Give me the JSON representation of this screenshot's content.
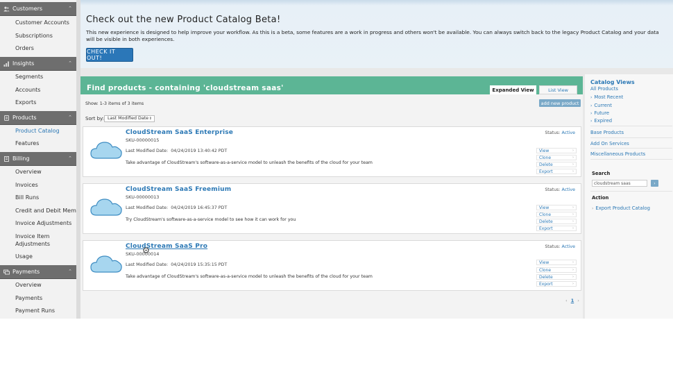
{
  "sidebar": {
    "sections": [
      {
        "title": "Customers",
        "items": [
          "Customer Accounts",
          "Subscriptions",
          "Orders"
        ]
      },
      {
        "title": "Insights",
        "items": [
          "Segments",
          "Accounts",
          "Exports"
        ]
      },
      {
        "title": "Products",
        "items": [
          "Product Catalog",
          "Features"
        ],
        "active_item": "Product Catalog"
      },
      {
        "title": "Billing",
        "items": [
          "Overview",
          "Invoices",
          "Bill Runs",
          "Credit and Debit Memos",
          "Invoice Adjustments",
          "Invoice Item Adjustments",
          "Usage"
        ]
      },
      {
        "title": "Payments",
        "items": [
          "Overview",
          "Payments",
          "Payment Runs"
        ]
      }
    ]
  },
  "banner": {
    "title": "Check out the new Product Catalog Beta!",
    "text": "This new experience is designed to help improve your workflow. As this is a beta, some features are a work in progress and others won't be available. You can always switch back to the legacy Product Catalog and your data will be visible in both experiences.",
    "button_label": "CHECK IT OUT!"
  },
  "results": {
    "title": "Find products - containing 'cloudstream saas'",
    "tab_expanded": "Expanded View",
    "tab_list": "List View",
    "show_text": "Show: 1-3 items of 3 items",
    "add_button": "add new product",
    "sort_label": "Sort by:",
    "sort_value": "Last Modified Date",
    "date_label": "Last Modified Date:",
    "status_label": "Status:",
    "actions": [
      "View",
      "Clone",
      "Delete",
      "Export"
    ],
    "products": [
      {
        "name": "CloudStream SaaS Enterprise",
        "sku": "SKU-00000015",
        "date": "04/24/2019 13:40:42 PDT",
        "status": "Active",
        "description": "Take advantage of CloudStream's software-as-a-service model to unleash the benefits of the cloud for your team"
      },
      {
        "name": "CloudStream SaaS Freemium",
        "sku": "SKU-00000013",
        "date": "04/24/2019 16:45:37 PDT",
        "status": "Active",
        "description": "Try CloudStream's software-as-a-service model to see how it can work for you"
      },
      {
        "name": "CloudStream SaaS Pro",
        "sku": "SKU-00000014",
        "date": "04/24/2019 15:35:15 PDT",
        "status": "Active",
        "description": "Take advantage of CloudStream's software-as-a-service model to unleash the benefits of the cloud for your team"
      }
    ],
    "pager": {
      "prev": "‹",
      "page": "1",
      "next": "›"
    }
  },
  "right_panel": {
    "catalog_views_title": "Catalog Views",
    "all_products": "All Products",
    "view_links": [
      "Most Recent",
      "Current",
      "Future",
      "Expired"
    ],
    "base_products": "Base Products",
    "add_on_services": "Add On Services",
    "misc_products": "Miscellaneous Products",
    "search_label": "Search",
    "search_value": "cloudstream saas",
    "action_label": "Action",
    "export_link": "Export Product Catalog"
  },
  "colors": {
    "accent": "#2b78b5",
    "header_green": "#5cb595",
    "sidebar_header": "#6e6e6e",
    "button_blue": "#2b77b8"
  }
}
